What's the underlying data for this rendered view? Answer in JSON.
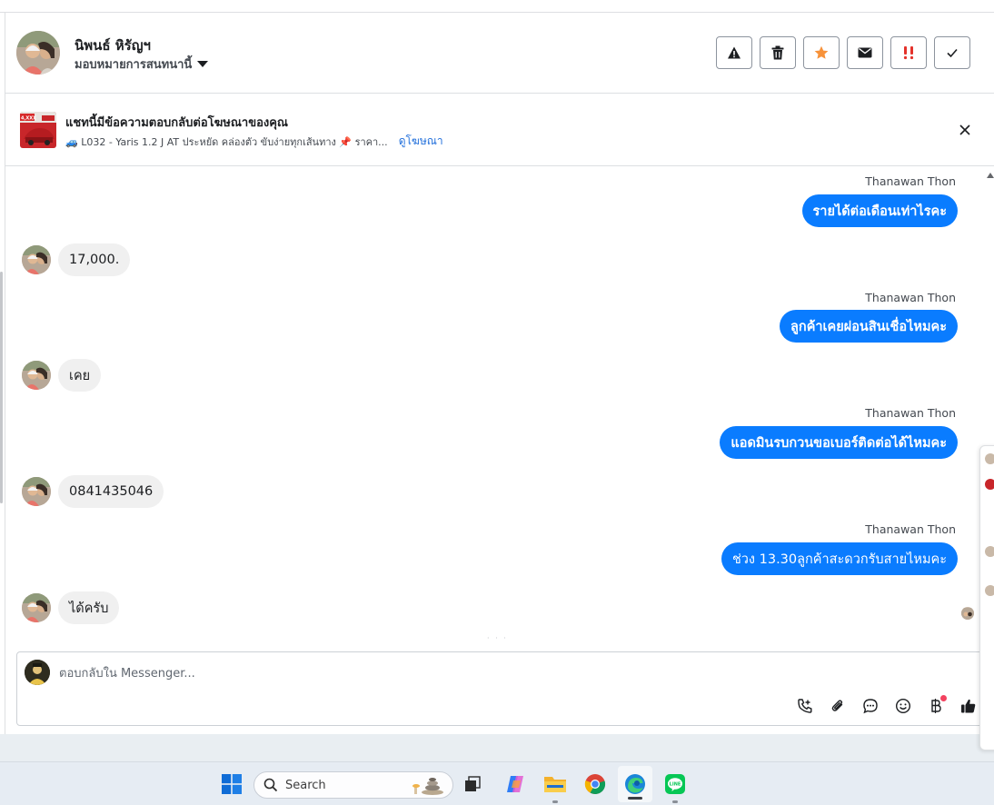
{
  "header": {
    "contact_name": "นิพนธ์ หิรัญฯ",
    "assign_label": "มอบหมายการสนทนานี้"
  },
  "actions": [
    {
      "name": "warning-icon",
      "label": "Report"
    },
    {
      "name": "trash-icon",
      "label": "Delete"
    },
    {
      "name": "star-icon",
      "label": "Star"
    },
    {
      "name": "envelope-icon",
      "label": "Mark unread"
    },
    {
      "name": "priority-icon",
      "label": "Priority"
    },
    {
      "name": "check-icon",
      "label": "Done"
    }
  ],
  "ad_banner": {
    "title": "แชทนี้มีข้อความตอบกลับต่อโฆษณาของคุณ",
    "subtitle": "🚙 L032 - Yaris 1.2 J AT ประหยัด คล่องตัว ขับง่ายทุกเส้นทาง 📌 ราคา...",
    "link": "ดูโฆษณา",
    "thumb_badge": "4,XXX"
  },
  "messages": [
    {
      "dir": "out",
      "sender": "Thanawan Thon",
      "text": "รายได้ต่อเดือนเท่าไรคะ"
    },
    {
      "dir": "in",
      "text": "17,000."
    },
    {
      "dir": "out",
      "sender": "Thanawan Thon",
      "text": "ลูกค้าเคยผ่อนสินเชื่อไหมคะ"
    },
    {
      "dir": "in",
      "text": "เคย"
    },
    {
      "dir": "out",
      "sender": "Thanawan Thon",
      "text": "แอดมินรบกวนขอเบอร์ติดต่อได้ไหมคะ"
    },
    {
      "dir": "in",
      "text": "0841435046"
    },
    {
      "dir": "out",
      "sender": "Thanawan Thon",
      "text": "ช่วง 13.30ลูกค้าสะดวกรับสายไหมคะ"
    },
    {
      "dir": "in",
      "text": "ได้ครับ"
    }
  ],
  "composer": {
    "placeholder": "ตอบกลับใน Messenger...",
    "value": ""
  },
  "taskbar": {
    "search_label": "Search"
  },
  "colors": {
    "outgoing_bubble": "#0a7cff",
    "incoming_bubble": "#f0f0f0",
    "star": "#f7923a",
    "priority": "#e4322b"
  }
}
